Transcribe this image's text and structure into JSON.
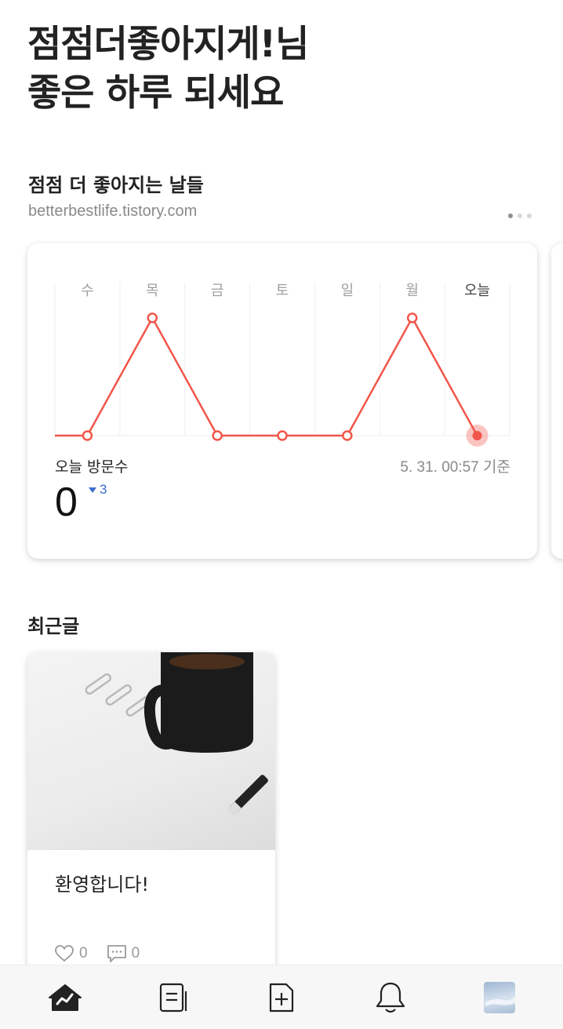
{
  "greeting": {
    "line1": "점점더좋아지게!님",
    "line2": "좋은 하루 되세요"
  },
  "blog": {
    "title": "점점 더 좋아지는 날들",
    "url": "betterbestlife.tistory.com"
  },
  "pager": {
    "count": 3,
    "active": 0
  },
  "stats": {
    "visitors_label": "오늘 방문수",
    "basis": "5. 31. 00:57 기준",
    "count": "0",
    "delta": "3",
    "delta_direction": "down"
  },
  "chart_data": {
    "type": "line",
    "categories": [
      "수",
      "목",
      "금",
      "토",
      "일",
      "월",
      "오늘"
    ],
    "values": [
      0,
      1,
      0,
      0,
      0,
      1,
      0
    ],
    "ylim": [
      0,
      1
    ],
    "grid": true,
    "color": "#f2564a"
  },
  "recent": {
    "title": "최근글"
  },
  "posts": [
    {
      "title": "환영합니다!",
      "likes": "0",
      "comments": "0"
    }
  ],
  "nav": {
    "items": [
      "stats-icon",
      "posts-icon",
      "new-post-icon",
      "notification-icon",
      "profile-avatar"
    ]
  }
}
